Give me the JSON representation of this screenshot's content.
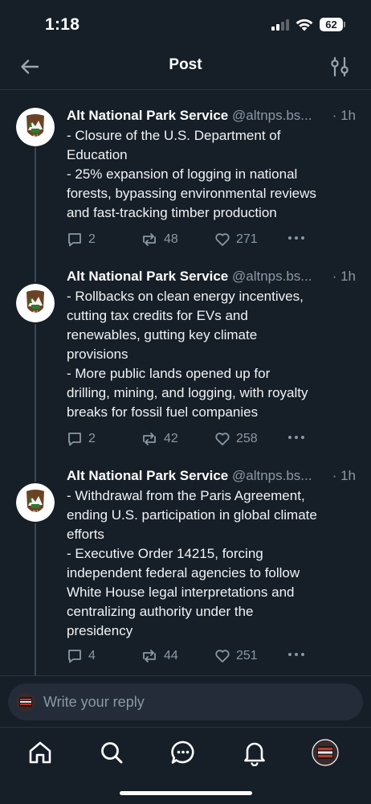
{
  "status_bar": {
    "time": "1:18",
    "battery": "62"
  },
  "header": {
    "title": "Post",
    "back_icon": "arrow-left-icon",
    "filter_icon": "sliders-icon"
  },
  "posts": [
    {
      "author": "Alt National Park Service",
      "handle": "@altnps.bs...",
      "time": "· 1h",
      "lines": [
        "- Closure of the U.S. Department of",
        "Education",
        "- 25% expansion of logging in national",
        "forests, bypassing environmental reviews",
        "and fast-tracking timber production"
      ],
      "replies": "2",
      "reposts": "48",
      "likes": "271"
    },
    {
      "author": "Alt National Park Service",
      "handle": "@altnps.bs...",
      "time": "· 1h",
      "lines": [
        "- Rollbacks on clean energy incentives,",
        "cutting tax credits for EVs and",
        "renewables, gutting key climate",
        "provisions",
        "- More public lands opened up for",
        "drilling, mining, and logging, with royalty",
        "breaks for fossil fuel companies"
      ],
      "replies": "2",
      "reposts": "42",
      "likes": "258"
    },
    {
      "author": "Alt National Park Service",
      "handle": "@altnps.bs...",
      "time": "· 1h",
      "lines": [
        "- Withdrawal from the Paris Agreement,",
        "ending U.S. participation in global climate",
        "efforts",
        "- Executive Order 14215, forcing",
        "independent federal agencies to follow",
        "White House legal interpretations and",
        "centralizing authority under the",
        "presidency"
      ],
      "replies": "4",
      "reposts": "44",
      "likes": "251"
    }
  ],
  "reply": {
    "placeholder": "Write your reply"
  },
  "tabs": [
    {
      "name": "home-icon"
    },
    {
      "name": "search-icon"
    },
    {
      "name": "chat-icon"
    },
    {
      "name": "bell-icon"
    },
    {
      "name": "profile-avatar"
    }
  ],
  "colors": {
    "background": "#161e27",
    "muted": "#8b98a5",
    "divider": "#2a3440"
  }
}
